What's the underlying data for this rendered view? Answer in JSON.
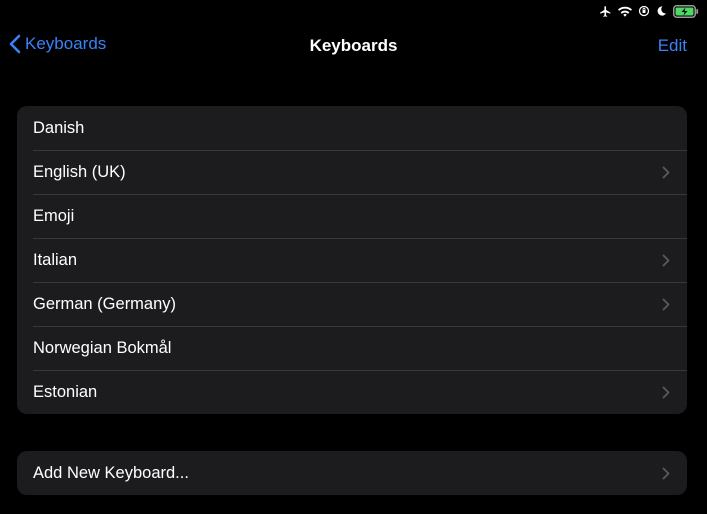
{
  "status_bar": {
    "icons": [
      "airplane-icon",
      "wifi-icon",
      "orientation-lock-icon",
      "moon-icon",
      "battery-charging-icon"
    ],
    "battery_color": "#4cd964"
  },
  "nav": {
    "back_label": "Keyboards",
    "title": "Keyboards",
    "edit_label": "Edit"
  },
  "keyboards": [
    {
      "label": "Danish",
      "has_chevron": false
    },
    {
      "label": "English (UK)",
      "has_chevron": true
    },
    {
      "label": "Emoji",
      "has_chevron": false
    },
    {
      "label": "Italian",
      "has_chevron": true
    },
    {
      "label": "German (Germany)",
      "has_chevron": true
    },
    {
      "label": "Norwegian Bokmål",
      "has_chevron": false
    },
    {
      "label": "Estonian",
      "has_chevron": true
    }
  ],
  "add_keyboard": {
    "label": "Add New Keyboard..."
  },
  "colors": {
    "accent": "#3a82f7",
    "background": "#000000",
    "cell": "#1c1c1e",
    "separator": "#38383a",
    "chevron": "#5a5a5e"
  }
}
